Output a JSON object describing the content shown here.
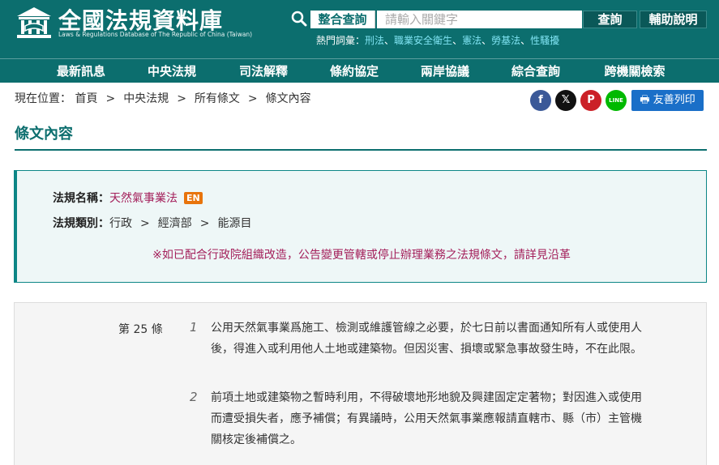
{
  "header": {
    "logo_title": "全國法規資料庫",
    "logo_subtitle": "Laws & Regulations Database of The Republic of China (Taiwan)",
    "search_label": "整合查詢",
    "search_placeholder": "請輸入關鍵字",
    "search_button": "查詢",
    "help_button": "輔助說明",
    "hot_words_label": "熱門詞彙：",
    "hot_words": [
      "刑法",
      "職業安全衛生",
      "憲法",
      "勞基法",
      "性騷擾"
    ],
    "hot_sep": "、"
  },
  "nav": {
    "items": [
      "最新訊息",
      "中央法規",
      "司法解釋",
      "條約協定",
      "兩岸協議",
      "綜合查詢",
      "跨機關檢索"
    ]
  },
  "breadcrumb": {
    "label": "現在位置：",
    "items": [
      "首頁",
      "中央法規",
      "所有條文",
      "條文內容"
    ],
    "sep": ">"
  },
  "share": {
    "facebook": "f",
    "x": "𝕏",
    "pinterest": "P",
    "line": "LINE",
    "print_label": "友善列印"
  },
  "page_title": "條文內容",
  "info": {
    "name_label": "法規名稱：",
    "name_value": "天然氣事業法",
    "en_badge": "EN",
    "category_label": "法規類別：",
    "categories": [
      "行政",
      "經濟部",
      "能源目"
    ],
    "category_sep": ">",
    "notice": "※如已配合行政院組織改造，公告變更管轄或停止辦理業務之法規條文，請詳見沿革"
  },
  "article": {
    "number": "第 25 條",
    "paragraphs": [
      {
        "no": "1",
        "text": "公用天然氣事業爲施工、檢測或維護管線之必要，於七日前以書面通知所有人或使用人後，得進入或利用他人土地或建築物。但因災害、損壞或緊急事故發生時，不在此限。"
      },
      {
        "no": "2",
        "text": "前項土地或建築物之暫時利用，不得破壞地形地貌及興建固定定著物；對因進入或使用而遭受損失者，應予補償；有異議時，公用天然氣事業應報請直轄市、縣（市）主管機關核定後補償之。"
      }
    ]
  },
  "colors": {
    "brand_teal": "#0c6e6e",
    "accent_magenta": "#a4205b",
    "en_orange": "#e8740c",
    "print_blue": "#1a6fc8",
    "facebook": "#3b5998",
    "x": "#111111",
    "pinterest": "#cb2027",
    "line": "#00b900"
  }
}
